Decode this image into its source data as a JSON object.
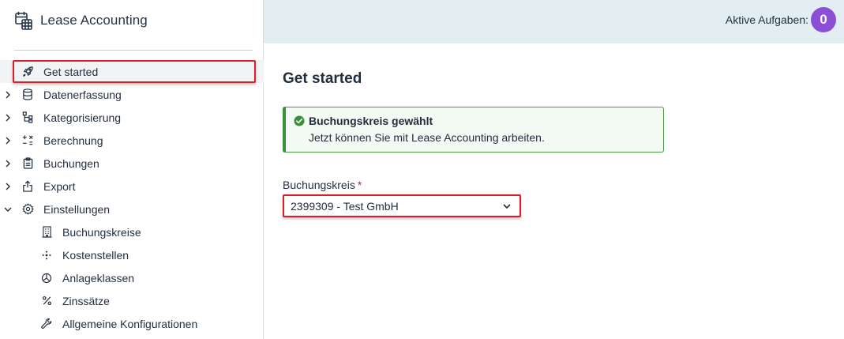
{
  "app": {
    "title": "Lease Accounting",
    "icon": "calendar-grid-icon"
  },
  "sidebar": {
    "items": [
      {
        "label": "Get started",
        "icon": "rocket-icon",
        "expandable": false,
        "active": true
      },
      {
        "label": "Datenerfassung",
        "icon": "database-icon",
        "expandable": true
      },
      {
        "label": "Kategorisierung",
        "icon": "hierarchy-icon",
        "expandable": true
      },
      {
        "label": "Berechnung",
        "icon": "calculator-icon",
        "expandable": true
      },
      {
        "label": "Buchungen",
        "icon": "clipboard-icon",
        "expandable": true
      },
      {
        "label": "Export",
        "icon": "export-icon",
        "expandable": true
      },
      {
        "label": "Einstellungen",
        "icon": "gear-icon",
        "expandable": true,
        "expanded": true
      }
    ],
    "subitems": [
      {
        "label": "Buchungskreise",
        "icon": "building-icon"
      },
      {
        "label": "Kostenstellen",
        "icon": "sparkle-icon"
      },
      {
        "label": "Anlageklassen",
        "icon": "pie-chart-icon"
      },
      {
        "label": "Zinssätze",
        "icon": "percent-icon"
      },
      {
        "label": "Allgemeine Konfigurationen",
        "icon": "wrench-icon"
      }
    ]
  },
  "header": {
    "tasks_label": "Aktive Aufgaben:",
    "tasks_count": "0"
  },
  "main": {
    "title": "Get started",
    "alert": {
      "title": "Buchungskreis gewählt",
      "text": "Jetzt können Sie mit Lease Accounting arbeiten."
    },
    "field": {
      "label": "Buchungskreis",
      "required_mark": "*",
      "value": "2399309 - Test GmbH"
    }
  },
  "colors": {
    "accent": "#8a4fd6",
    "highlight": "#d8202a",
    "success": "#3b8f3b",
    "topbar": "#e3eef3"
  }
}
